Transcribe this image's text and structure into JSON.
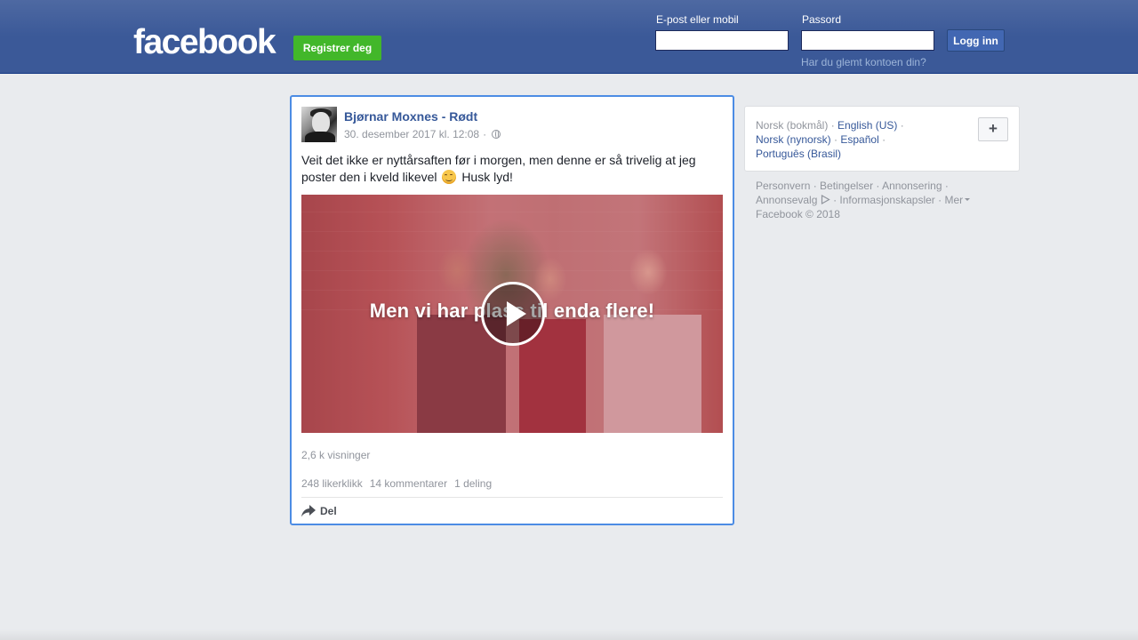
{
  "header": {
    "logo": "facebook",
    "register_label": "Registrer deg",
    "email_label": "E-post eller mobil",
    "email_value": "",
    "password_label": "Passord",
    "password_value": "",
    "login_label": "Logg inn",
    "forgot_label": "Har du glemt kontoen din?"
  },
  "post": {
    "author": "Bjørnar Moxnes - Rødt",
    "timestamp": "30. desember 2017 kl. 12:08",
    "meta_separator": "·",
    "text_before_emoji": "Veit det ikke er nyttårsaften før i morgen, men denne er så trivelig at jeg poster den i kveld likevel",
    "text_after_emoji": "Husk lyd!",
    "video_caption": "Men vi har plass til enda flere!",
    "views": "2,6 k visninger",
    "likes": "248 likerklikk",
    "comments": "14 kommentarer",
    "shares": "1 deling",
    "share_action": "Del"
  },
  "languages": {
    "current": "Norsk (bokmål)",
    "items": [
      "English (US)",
      "Norsk (nynorsk)",
      "Español",
      "Português (Brasil)"
    ],
    "more_label": "+"
  },
  "footer": {
    "links": [
      "Personvern",
      "Betingelser",
      "Annonsering",
      "Annonsevalg",
      "Informasjonskapsler",
      "Mer"
    ],
    "copyright": "Facebook © 2018"
  },
  "colors": {
    "header_bg": "#3b5998",
    "register_green": "#42b72a",
    "link_blue": "#365899",
    "focus_border": "#4c8ce4"
  }
}
